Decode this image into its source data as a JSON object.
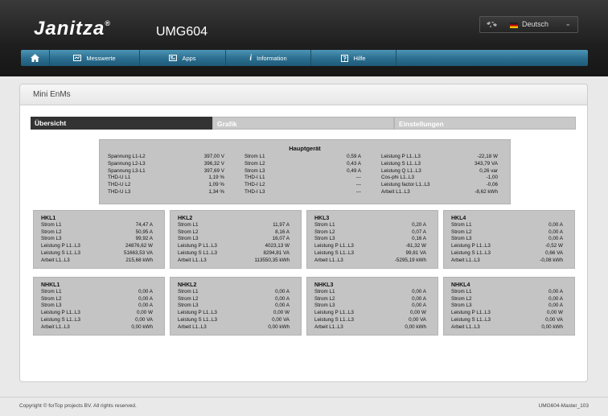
{
  "header": {
    "brand": "Janitza",
    "reg": "®",
    "model": "UMG604",
    "language": "Deutsch"
  },
  "nav": [
    {
      "label": "Messwerte",
      "icon": "meter-icon"
    },
    {
      "label": "Apps",
      "icon": "apps-icon"
    },
    {
      "label": "Information",
      "icon": "info-icon"
    },
    {
      "label": "Hilfe",
      "icon": "help-icon"
    }
  ],
  "panel": {
    "title": "Mini EnMs"
  },
  "tabs": [
    {
      "label": "Übersicht",
      "active": true
    },
    {
      "label": "Grafik",
      "active": false
    },
    {
      "label": "Einstellungen",
      "active": false
    }
  ],
  "main": {
    "title": "Hauptgerät",
    "columns": [
      [
        [
          "Spannung L1-L2",
          "397,00 V"
        ],
        [
          "Spannung L2-L3",
          "396,32 V"
        ],
        [
          "Spannung L3-L1",
          "397,69 V"
        ],
        [
          "THD-U L1",
          "1,19 %"
        ],
        [
          "THD-U L2",
          "1,09 %"
        ],
        [
          "THD-U L3",
          "1,34 %"
        ]
      ],
      [
        [
          "Strom L1",
          "0,59 A"
        ],
        [
          "Strom L2",
          "0,43 A"
        ],
        [
          "Strom L3",
          "0,49 A"
        ],
        [
          "THD-I L1",
          "---"
        ],
        [
          "THD-I L2",
          "---"
        ],
        [
          "THD-I L3",
          "---"
        ]
      ],
      [
        [
          "Leistung P L1..L3",
          "-22,18 W"
        ],
        [
          "Leistung S L1..L3",
          "343,79 VA"
        ],
        [
          "Leistung Q L1..L3",
          "0,26 var"
        ],
        [
          "Cos-phi L1..L3",
          "-1,00"
        ],
        [
          "Leistung factor L1..L3",
          "-0,06"
        ],
        [
          "Arbeit L1..L3",
          "-8,62 kWh"
        ]
      ]
    ]
  },
  "hkl": [
    {
      "name": "HKL1",
      "rows": [
        [
          "Strom L1",
          "74,47 A"
        ],
        [
          "Strom L2",
          "50,95 A"
        ],
        [
          "Strom L3",
          "99,92 A"
        ],
        [
          "Leistung P L1..L3",
          "24876,62 W"
        ],
        [
          "Leistung S L1..L3",
          "51663,53 VA"
        ],
        [
          "Arbeit L1..L3",
          "215,68 kWh"
        ]
      ]
    },
    {
      "name": "HKL2",
      "rows": [
        [
          "Strom L1",
          "11,97 A"
        ],
        [
          "Strom L2",
          "8,16 A"
        ],
        [
          "Strom L3",
          "16,07 A"
        ],
        [
          "Leistung P L1..L3",
          "4023,13 W"
        ],
        [
          "Leistung S L1..L3",
          "8294,81 VA"
        ],
        [
          "Arbeit L1..L3",
          "113550,35 kWh"
        ]
      ]
    },
    {
      "name": "HKL3",
      "rows": [
        [
          "Strom L1",
          "0,20 A"
        ],
        [
          "Strom L2",
          "0,07 A"
        ],
        [
          "Strom L3",
          "0,16 A"
        ],
        [
          "Leistung P L1..L3",
          "-61,32 W"
        ],
        [
          "Leistung S L1..L3",
          "99,81 VA"
        ],
        [
          "Arbeit L1..L3",
          "-5295,19 kWh"
        ]
      ]
    },
    {
      "name": "HKL4",
      "rows": [
        [
          "Strom L1",
          "0,00 A"
        ],
        [
          "Strom L2",
          "0,00 A"
        ],
        [
          "Strom L3",
          "0,00 A"
        ],
        [
          "Leistung P L1..L3",
          "-0,52 W"
        ],
        [
          "Leistung S L1..L3",
          "0,66 VA"
        ],
        [
          "Arbeit L1..L3",
          "-0,08 kWh"
        ]
      ]
    }
  ],
  "nhkl": [
    {
      "name": "NHKL1",
      "rows": [
        [
          "Strom L1",
          "0,00 A"
        ],
        [
          "Strom L2",
          "0,00 A"
        ],
        [
          "Strom L3",
          "0,00 A"
        ],
        [
          "Leistung P L1..L3",
          "0,00 W"
        ],
        [
          "Leistung S L1..L3",
          "0,00 VA"
        ],
        [
          "Arbeit L1..L3",
          "0,00 kWh"
        ]
      ]
    },
    {
      "name": "NHKL2",
      "rows": [
        [
          "Strom L1",
          "0,00 A"
        ],
        [
          "Strom L2",
          "0,00 A"
        ],
        [
          "Strom L3",
          "0,00 A"
        ],
        [
          "Leistung P L1..L3",
          "0,00 W"
        ],
        [
          "Leistung S L1..L3",
          "0,00 VA"
        ],
        [
          "Arbeit L1..L3",
          "0,00 kWh"
        ]
      ]
    },
    {
      "name": "NHKL3",
      "rows": [
        [
          "Strom L1",
          "0,00 A"
        ],
        [
          "Strom L2",
          "0,00 A"
        ],
        [
          "Strom L3",
          "0,00 A"
        ],
        [
          "Leistung P L1..L3",
          "0,00 W"
        ],
        [
          "Leistung S L1..L3",
          "0,00 VA"
        ],
        [
          "Arbeit L1..L3",
          "0,00 kWh"
        ]
      ]
    },
    {
      "name": "NHKL4",
      "rows": [
        [
          "Strom L1",
          "0,00 A"
        ],
        [
          "Strom L2",
          "0,00 A"
        ],
        [
          "Strom L3",
          "0,00 A"
        ],
        [
          "Leistung P L1..L3",
          "0,00 W"
        ],
        [
          "Leistung S L1..L3",
          "0,00 VA"
        ],
        [
          "Arbeit L1..L3",
          "0,00 kWh"
        ]
      ]
    }
  ],
  "footer": {
    "copyright": "Copyright © forTop projects BV. All rights reserved.",
    "version": "UMG604-Master_103"
  }
}
